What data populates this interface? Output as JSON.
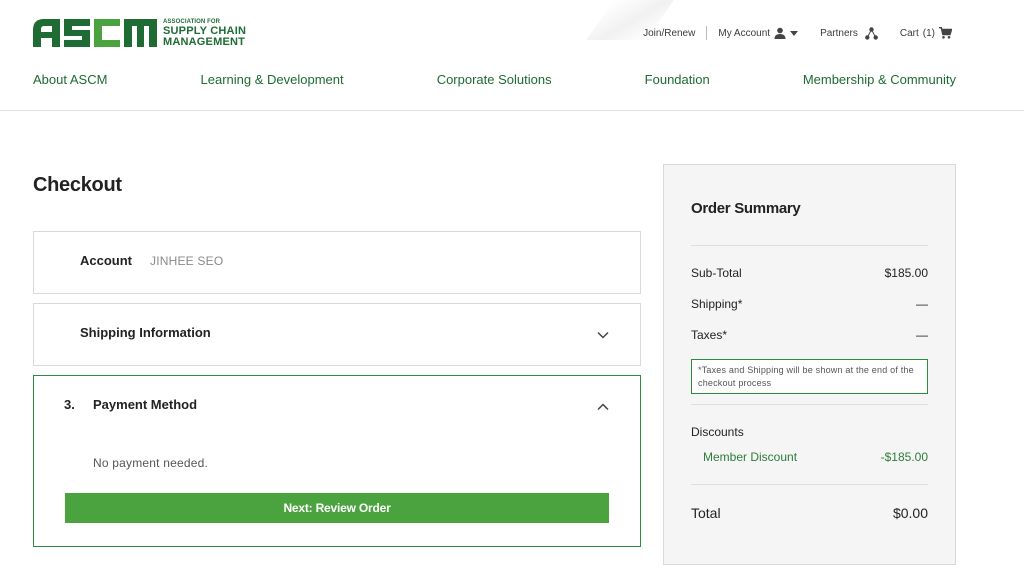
{
  "brand": {
    "logo_mark": "ASCM",
    "association_for": "ASSOCIATION FOR",
    "line1": "SUPPLY CHAIN",
    "line2": "MANAGEMENT",
    "green": "#1e6b33",
    "accent_green": "#4aa33e"
  },
  "utility": {
    "join": "Join/Renew",
    "account": "My Account",
    "partners": "Partners",
    "cart": "Cart",
    "cart_count": "(1)"
  },
  "nav": {
    "items": [
      {
        "label": "About ASCM"
      },
      {
        "label": "Learning & Development"
      },
      {
        "label": "Corporate Solutions"
      },
      {
        "label": "Foundation"
      },
      {
        "label": "Membership & Community"
      }
    ]
  },
  "checkout": {
    "title": "Checkout",
    "account": {
      "label": "Account",
      "value": "JINHEE SEO"
    },
    "shipping": {
      "label": "Shipping Information"
    },
    "payment": {
      "step": "3.",
      "label": "Payment Method",
      "message": "No payment needed.",
      "button": "Next: Review Order"
    }
  },
  "summary": {
    "title": "Order Summary",
    "subtotal_label": "Sub-Total",
    "subtotal_value": "$185.00",
    "shipping_label": "Shipping*",
    "shipping_value": "—",
    "taxes_label": "Taxes*",
    "taxes_value": "—",
    "note": "*Taxes and Shipping will be shown at the end of the checkout process",
    "discounts_label": "Discounts",
    "member_discount_label": "Member Discount",
    "member_discount_value": "-$185.00",
    "total_label": "Total",
    "total_value": "$0.00"
  }
}
